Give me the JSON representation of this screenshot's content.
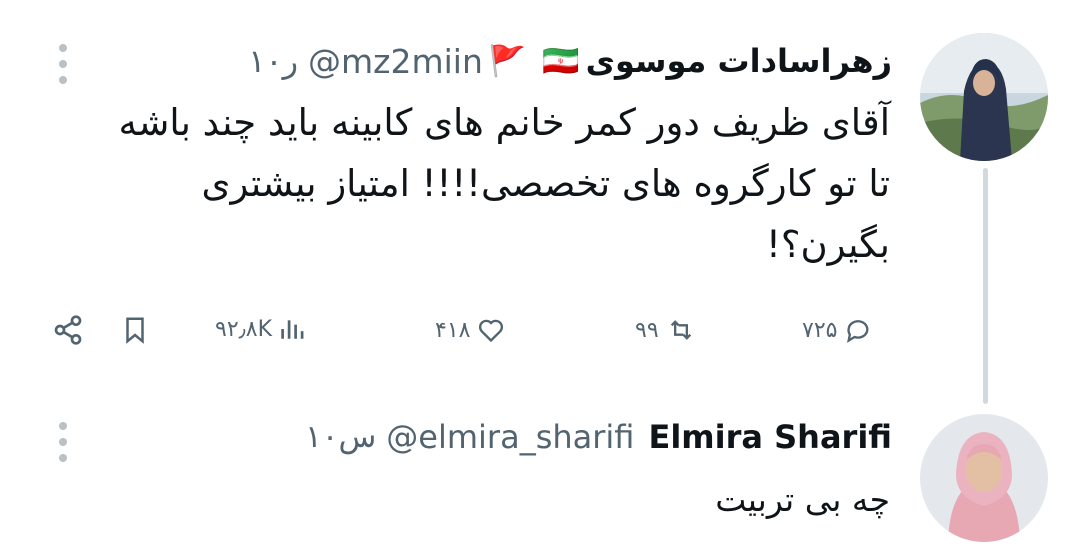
{
  "tweet1": {
    "name": "زهراسادات موسوی",
    "handle": "@mz2miin",
    "time": "۱۰ر",
    "flag_emoji": "🇮🇷",
    "red_flag_emoji": "🚩",
    "text_lines": [
      "آقای ظریف دور کمر خانم های کابینه باید چند باشه",
      "تا تو کارگروه های تخصصی!!!! امتیاز بیشتری",
      "بگیرن؟!"
    ],
    "stats": {
      "replies": "۷۲۵",
      "retweets": "۹۹",
      "likes": "۴۱۸",
      "views": "۹۲٫۸K"
    }
  },
  "tweet2": {
    "name": "Elmira Sharifi",
    "handle": "@elmira_sharifi",
    "time": "۱۰س",
    "text": "چه بی تربیت"
  },
  "icons": {
    "more": "more-vertical-icon",
    "reply": "reply-icon",
    "retweet": "retweet-icon",
    "like": "heart-icon",
    "views": "views-icon",
    "bookmark": "bookmark-icon",
    "share": "share-icon"
  },
  "colors": {
    "text_primary": "#0f1419",
    "text_secondary": "#536471",
    "thread_line": "#cfd9de",
    "background": "#ffffff"
  }
}
